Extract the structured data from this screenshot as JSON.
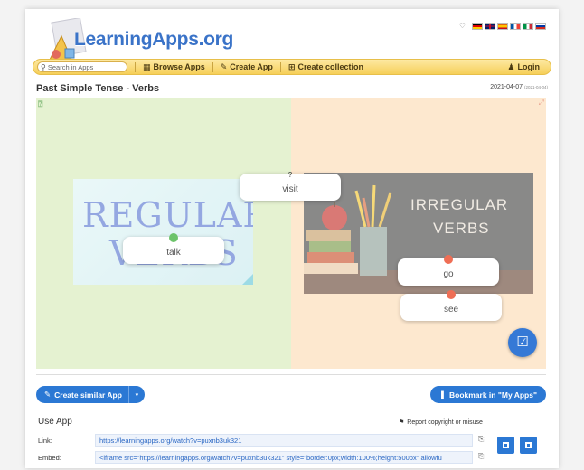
{
  "brand": {
    "name": "LearningApps.org"
  },
  "languages": [
    "de",
    "en",
    "es",
    "fr",
    "it",
    "ru"
  ],
  "nav": {
    "search_placeholder": "Search in Apps",
    "browse": "Browse Apps",
    "create_app": "Create App",
    "create_collection": "Create collection",
    "login": "Login"
  },
  "app": {
    "title": "Past Simple Tense - Verbs",
    "date": "2021-04-07",
    "date_small": "(2021-04-04)",
    "question_mark": "?",
    "tiles": [
      {
        "label": "visit",
        "dot": ""
      },
      {
        "label": "talk",
        "dot": "#6cc36a"
      },
      {
        "label": "go",
        "dot": "#ef6e55"
      },
      {
        "label": "see",
        "dot": "#ef6e55"
      }
    ],
    "left_image_text": [
      "REGULAR",
      "VERBS"
    ],
    "right_image_text": [
      "IRREGULAR",
      "VERBS"
    ]
  },
  "actions": {
    "create_similar": "Create similar App",
    "bookmark": "Bookmark in \"My Apps\""
  },
  "use_app": {
    "title": "Use App",
    "report": "Report copyright or misuse",
    "link_label": "Link:",
    "link_value": "https://learningapps.org/watch?v=puxnb3uk321",
    "embed_label": "Embed:",
    "embed_value": "<iframe src=\"https://learningapps.org/watch?v=puxnb3uk321\" style=\"border:0px;width:100%;height:500px\" allowfu"
  }
}
